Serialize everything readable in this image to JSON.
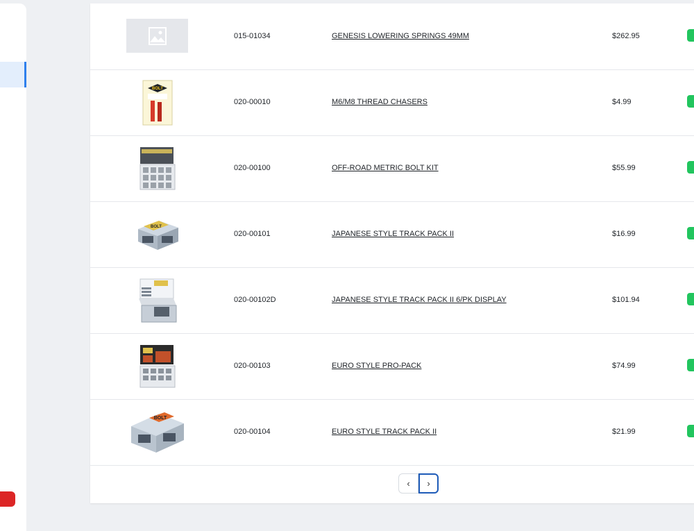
{
  "theme": {
    "accent": "#2f80ed",
    "stock_badge": "#22c55e",
    "danger": "#dc2626"
  },
  "products": [
    {
      "sku": "015-01034",
      "name": "GENESIS LOWERING SPRINGS 49MM",
      "price": "$262.95",
      "image": "placeholder-image-icon"
    },
    {
      "sku": "020-00010",
      "name": "M6/M8 THREAD CHASERS",
      "price": "$4.99",
      "image": "thread-chasers-package"
    },
    {
      "sku": "020-00100",
      "name": "OFF-ROAD METRIC BOLT KIT",
      "price": "$55.99",
      "image": "bolt-kit-case"
    },
    {
      "sku": "020-00101",
      "name": "JAPANESE STYLE TRACK PACK II",
      "price": "$16.99",
      "image": "track-pack-box"
    },
    {
      "sku": "020-00102D",
      "name": "JAPANESE STYLE TRACK PACK II 6/PK DISPLAY",
      "price": "$101.94",
      "image": "display-box"
    },
    {
      "sku": "020-00103",
      "name": "EURO STYLE PRO-PACK",
      "price": "$74.99",
      "image": "pro-pack-case"
    },
    {
      "sku": "020-00104",
      "name": "EURO STYLE TRACK PACK II",
      "price": "$21.99",
      "image": "euro-track-pack-box"
    }
  ],
  "pagination": {
    "prev": "‹",
    "next": "›"
  }
}
